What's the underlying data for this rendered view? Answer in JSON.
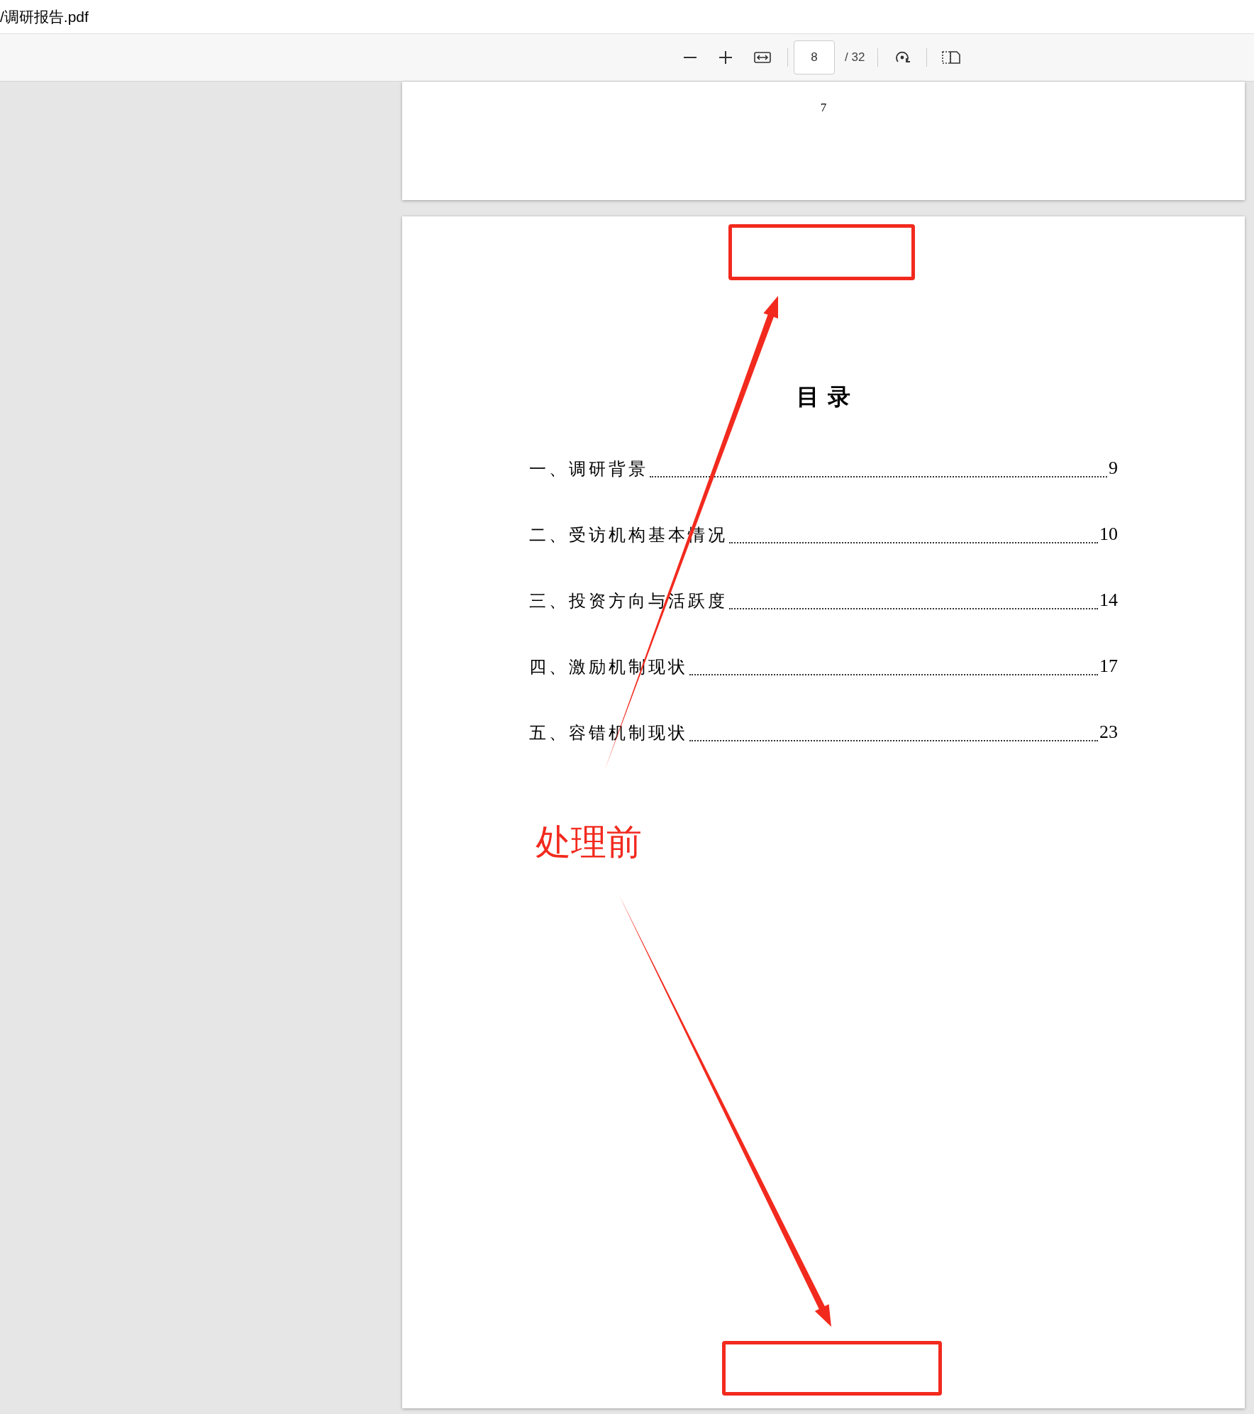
{
  "window": {
    "title": "/调研报告.pdf"
  },
  "toolbar": {
    "page_number": "8",
    "page_total": "/ 32"
  },
  "previous_page": {
    "page_footer": "7"
  },
  "current_page": {
    "toc_title": "目 录",
    "toc_entries": [
      {
        "label": "一、调研背景",
        "page": "9"
      },
      {
        "label": "二、受访机构基本情况",
        "page": "10"
      },
      {
        "label": "三、投资方向与活跃度",
        "page": "14"
      },
      {
        "label": "四、激励机制现状",
        "page": "17"
      },
      {
        "label": "五、容错机制现状",
        "page": "23"
      }
    ],
    "annotation_label": "处理前"
  }
}
